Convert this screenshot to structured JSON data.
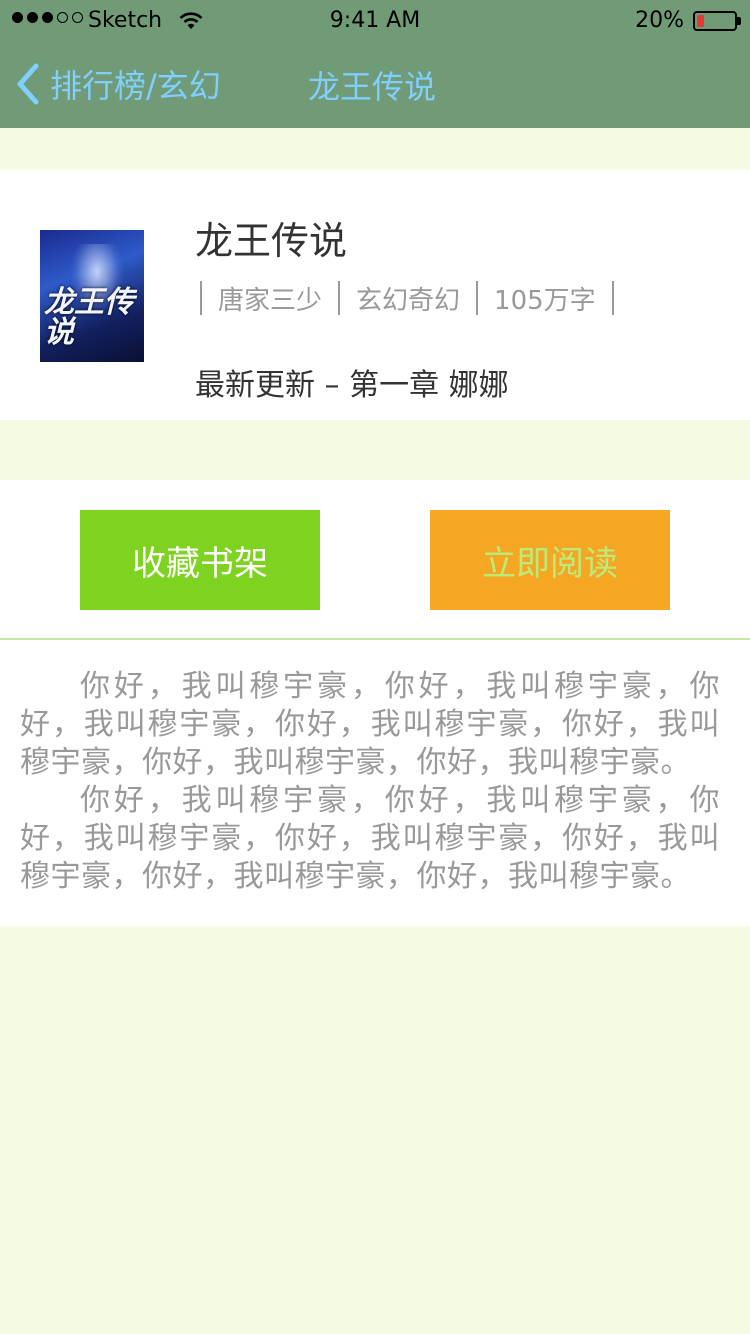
{
  "status_bar": {
    "carrier": "Sketch",
    "time": "9:41 AM",
    "battery_percent": "20%",
    "battery_level": 0.2,
    "signal_dots_filled": 3,
    "signal_dots_total": 5,
    "battery_color": "#E53935"
  },
  "nav": {
    "back_label": "排行榜/玄幻",
    "title": "龙王传说",
    "color": "#7FCFFF"
  },
  "book": {
    "cover_text": "龙王传说",
    "title": "龙王传说",
    "author": "唐家三少",
    "category": "玄幻奇幻",
    "word_count": "105万字",
    "latest_update": "最新更新 – 第一章 娜娜"
  },
  "actions": {
    "add_to_shelf": "收藏书架",
    "read_now": "立即阅读",
    "shelf_color": "#7ED321",
    "read_color": "#F5A623"
  },
  "description": {
    "paragraphs": [
      "你好，我叫穆宇豪，你好，我叫穆宇豪，你好，我叫穆宇豪，你好，我叫穆宇豪，你好，我叫穆宇豪，你好，我叫穆宇豪，你好，我叫穆宇豪。",
      "你好，我叫穆宇豪，你好，我叫穆宇豪，你好，我叫穆宇豪，你好，我叫穆宇豪，你好，我叫穆宇豪，你好，我叫穆宇豪，你好，我叫穆宇豪。"
    ]
  },
  "colors": {
    "header_bg": "#719A76",
    "page_bg": "#F5FAE3"
  }
}
